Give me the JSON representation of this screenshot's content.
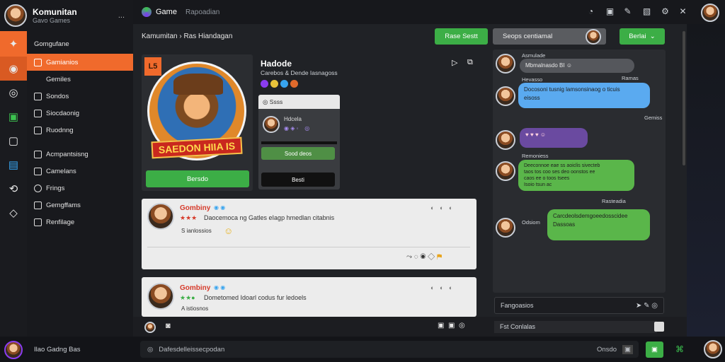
{
  "app": {
    "title": "Komunitan",
    "subtitle": "Gavo Games",
    "menu": "...",
    "nav_title": "Game",
    "nav_sub": "Rapoadian"
  },
  "sidebar": {
    "items": [
      {
        "label": "Gomgufane"
      },
      {
        "label": "Gamianios"
      },
      {
        "label": "Gemiles"
      },
      {
        "label": "Sondos"
      },
      {
        "label": "Siocdaonig"
      },
      {
        "label": "Ruodnng"
      },
      {
        "label": "Acmpantsisng"
      },
      {
        "label": "Camelans"
      },
      {
        "label": "Frings"
      },
      {
        "label": "Gemgffams"
      },
      {
        "label": "Renfilage"
      }
    ]
  },
  "user": {
    "name": "Ilao Gadng Bas"
  },
  "breadcrumb": "Kamumitan › Ras Hiandagan",
  "header": {
    "primary_btn": "Rase Sestt",
    "search": "Seops centiamal",
    "action_btn": "Berlai"
  },
  "profile": {
    "name": "Hadode",
    "stats": "Carebos & Dende Iasnagoss",
    "banner": "SAEDON HIIA IS",
    "ribbon": "L5",
    "cta": "Bersdo"
  },
  "popup": {
    "title": "Ssss",
    "user": "Hdcela",
    "btn1": "Sood deos",
    "btn2": "Besti"
  },
  "posts": [
    {
      "name": "Gombiny",
      "text": "Daocemoca ng Gatles eIagp hmedlan citabnis",
      "sub": "S ianlossios"
    },
    {
      "name": "Gombiny",
      "text": "Dometomed Idoarl codus fur ledoels",
      "sub": "A istiosnos"
    }
  ],
  "chat": {
    "messages": [
      {
        "label": "Asmulade",
        "text": "Mbmalnasdo BI"
      },
      {
        "label": "Hevasso",
        "time": "Ramas",
        "text": "Docosoni tusnig lamsonsinaog o ticuis",
        "sub": "eisoss"
      },
      {
        "label": "",
        "time": "Gemiss",
        "text": ""
      },
      {
        "label": "Remoniess",
        "text": "Deeconnoe eae ss aoiclis sivecteb\ntaos tos coo ses deo oonstos ee\ncaos ee o toos tsees",
        "sub": "Isoio tsun ac"
      },
      {
        "label": "Odsiom",
        "time": "Rasteadia",
        "text": "Carcdeolsdemgoeedosscidee",
        "sub": "Dassoas"
      }
    ],
    "input": "Fangoasios"
  },
  "toolbar": {
    "input": "Fst Conlalas"
  },
  "bottom": {
    "input": "Dafesdelleissecpodan",
    "label": "Onsdo"
  }
}
